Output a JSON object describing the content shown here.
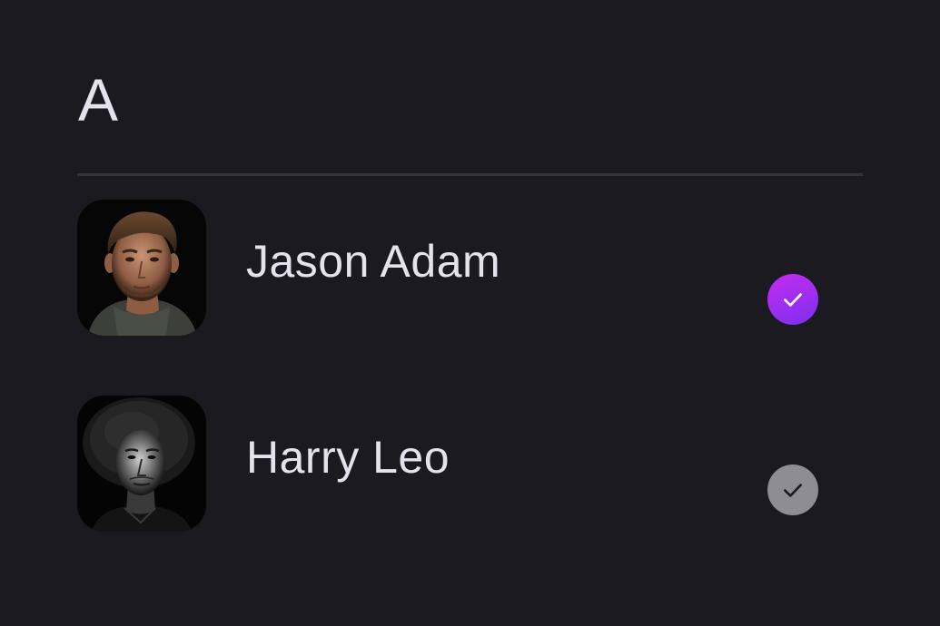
{
  "section": {
    "letter": "A"
  },
  "contacts": [
    {
      "name": "Jason Adam",
      "selected": true,
      "avatar_icon": "avatar-photo-icon"
    },
    {
      "name": "Harry Leo",
      "selected": false,
      "avatar_icon": "avatar-photo-icon"
    }
  ],
  "colors": {
    "background": "#1b1a20",
    "text": "#e4e2ec",
    "divider": "#34333a",
    "accent_start": "#c32cf0",
    "accent_end": "#7d2ff0",
    "check_unselected": "#8e8d93"
  },
  "icons": {
    "selected": "check-icon",
    "unselected": "check-icon"
  }
}
